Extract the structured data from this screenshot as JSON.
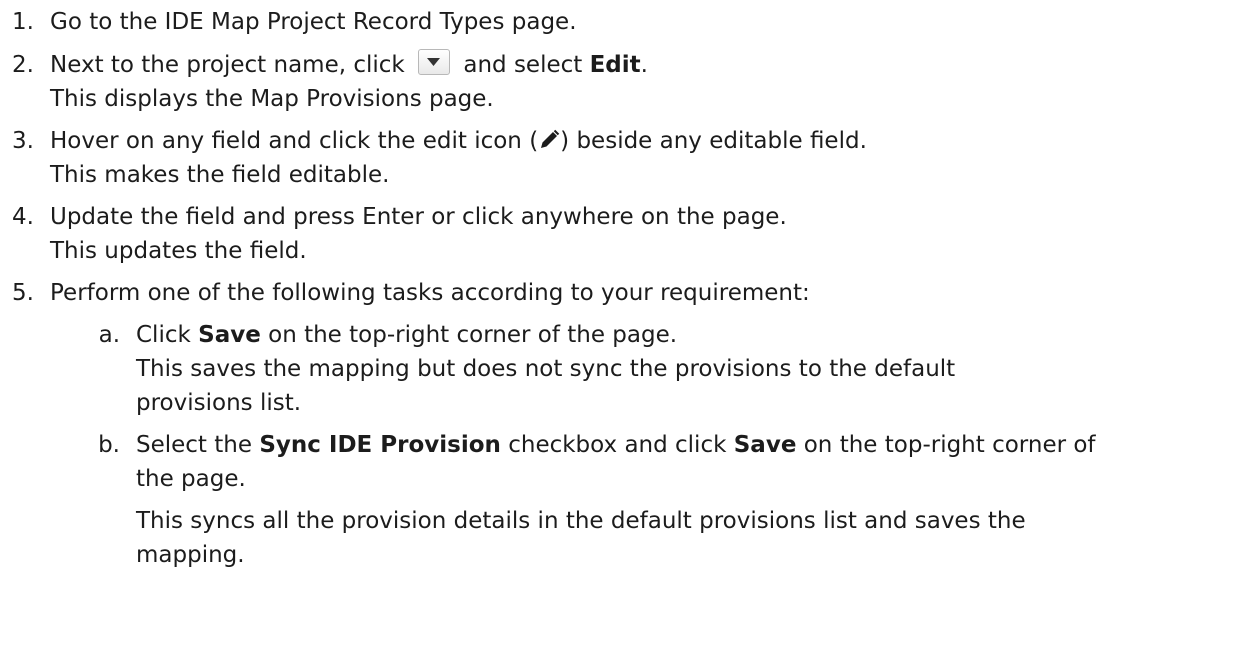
{
  "steps": [
    {
      "num": "1.",
      "text": "Go to the IDE Map Project Record Types page."
    },
    {
      "num": "2.",
      "pre": "Next to the project name, click",
      "mid": "and select",
      "bold": "Edit",
      "end": ".",
      "result": "This displays the Map Provisions page."
    },
    {
      "num": "3.",
      "pre": "Hover on any field and click the edit icon (",
      "post": ") beside any editable field.",
      "result": "This makes the field editable."
    },
    {
      "num": "4.",
      "text": "Update the field and press Enter or click anywhere on the page.",
      "result": "This updates the field."
    },
    {
      "num": "5.",
      "text": "Perform one of the following tasks according to your requirement:"
    }
  ],
  "substeps": [
    {
      "num": "a.",
      "pre": "Click",
      "bold": "Save",
      "post": "on the top-right corner of the page.",
      "result1": "This saves the mapping but does not sync the provisions to the default",
      "result2": "provisions list."
    },
    {
      "num": "b.",
      "pre": "Select the",
      "bold": "Sync IDE Provision",
      "mid": "checkbox and click",
      "bold2": "Save",
      "post": "on the top-right corner of",
      "cont": "the page.",
      "result1": "This syncs all the provision details in the default provisions list and saves the",
      "result2": "mapping."
    }
  ],
  "icons": {
    "dropdown": "dropdown-arrow-icon",
    "edit": "pencil-icon"
  },
  "colors": {
    "text": "#1c1c1c"
  }
}
